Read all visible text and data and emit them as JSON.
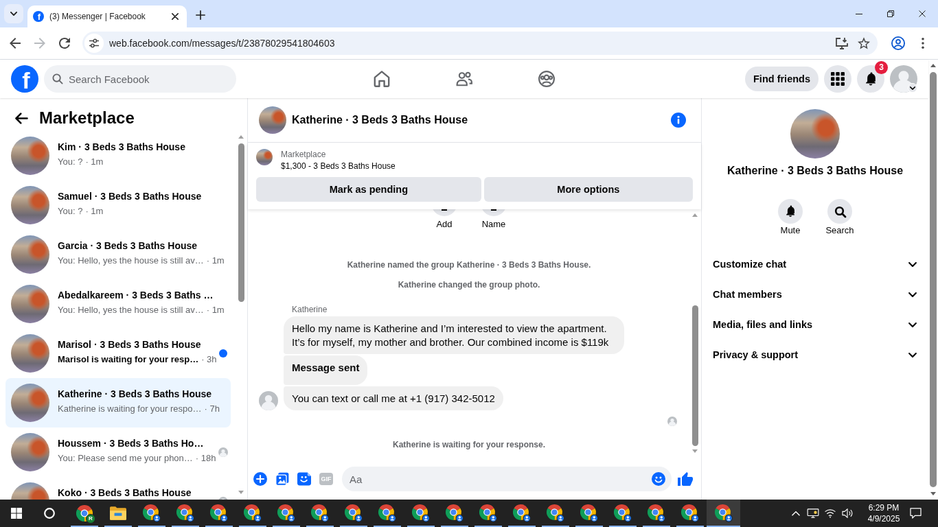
{
  "browser": {
    "tab": {
      "favicon": "f",
      "title": "(3) Messenger | Facebook"
    },
    "nav_buttons": [
      {
        "kind": "back",
        "disabled": false
      },
      {
        "kind": "forward",
        "disabled": true
      },
      {
        "kind": "reload",
        "disabled": false
      }
    ],
    "url": "web.facebook.com/messages/t/23878029541804603"
  },
  "topbar": {
    "logo": "f",
    "search": {
      "placeholder": "Search Facebook"
    },
    "nav": [
      {
        "kind": "home",
        "selected": false
      },
      {
        "kind": "friends",
        "selected": false
      },
      {
        "kind": "groups",
        "selected": false
      }
    ],
    "find_friends": "Find friends",
    "notifications": "3"
  },
  "sidebar": {
    "title": "Marketplace",
    "conversations": [
      {
        "name": "Kim · 3 Beds 3 Baths House",
        "snippet": "You: ?",
        "time": "· 1m",
        "selected": false,
        "unread": false,
        "seen": false
      },
      {
        "name": "Samuel · 3 Beds 3 Baths House",
        "snippet": "You: ?",
        "time": "· 1m",
        "selected": false,
        "unread": false,
        "seen": false
      },
      {
        "name": "Garcia · 3 Beds 3 Baths House",
        "snippet": "You: Hello, yes the house is still av…",
        "time": "· 1m",
        "selected": false,
        "unread": false,
        "seen": false
      },
      {
        "name": "Abedalkareem · 3 Beds 3 Baths …",
        "snippet": "You: Hello, yes the house is still av…",
        "time": "· 1m",
        "selected": false,
        "unread": false,
        "seen": false
      },
      {
        "name": "Marisol · 3 Beds 3 Baths House",
        "snippet": "Marisol is waiting for your resp…",
        "time": "· 3h",
        "selected": false,
        "unread": true,
        "seen": false
      },
      {
        "name": "Katherine · 3 Beds 3 Baths House",
        "snippet": "Katherine is waiting for your respo…",
        "time": "· 7h",
        "selected": true,
        "unread": false,
        "seen": false
      },
      {
        "name": "Houssem · 3 Beds 3 Baths Ho…",
        "snippet": "You: Please send me your phon…",
        "time": "· 18h",
        "selected": false,
        "unread": false,
        "seen": true
      },
      {
        "name": "Koko · 3 Beds 3 Baths House",
        "selected": false,
        "unread": false,
        "seen": true
      }
    ]
  },
  "chat": {
    "title": "Katherine · 3 Beds 3 Baths House",
    "listing": {
      "label": "Marketplace",
      "summary": "$1,300 - 3 Beds 3 Baths House",
      "actions": [
        "Mark as pending",
        "More options"
      ]
    },
    "group_actions": [
      "Add",
      "Name"
    ],
    "thread": [
      {
        "kind": "system",
        "text": "Katherine named the group Katherine · 3 Beds 3 Baths House."
      },
      {
        "kind": "system",
        "text": "Katherine changed the group photo."
      },
      {
        "kind": "sender",
        "text": "Katherine"
      },
      {
        "kind": "message",
        "text": "Hello my name is Katherine and I’m interested to view the apartment. It’s for myself, my mother and brother. Our combined income is $119k",
        "avatar": false
      },
      {
        "kind": "notice",
        "text": "Message sent",
        "avatar": false
      },
      {
        "kind": "message",
        "text": "You can text or call me at +1 (917) 342-5012",
        "avatar": true
      },
      {
        "kind": "seen"
      },
      {
        "kind": "system",
        "text": "Katherine is waiting for your response."
      }
    ],
    "composer": {
      "gif": "GIF",
      "placeholder": "Aa"
    }
  },
  "details": {
    "title": "Katherine · 3 Beds 3 Baths House",
    "actions": [
      {
        "kind": "mute",
        "label": "Mute"
      },
      {
        "kind": "search",
        "label": "Search"
      }
    ],
    "sections": [
      {
        "label": "Customize chat",
        "expanded": false
      },
      {
        "label": "Chat members",
        "expanded": false
      },
      {
        "label": "Media, files and links",
        "expanded": false
      },
      {
        "label": "Privacy & support",
        "expanded": false
      }
    ]
  },
  "taskbar": {
    "apps": [
      {
        "kind": "browser",
        "badge": "R",
        "selected": false
      },
      {
        "kind": "folder",
        "selected": false
      },
      {
        "kind": "browser",
        "selected": false
      },
      {
        "kind": "browser",
        "selected": false
      },
      {
        "kind": "browser",
        "selected": false
      },
      {
        "kind": "browser",
        "selected": false
      },
      {
        "kind": "browser",
        "selected": false
      },
      {
        "kind": "browser",
        "selected": false
      },
      {
        "kind": "browser",
        "selected": false
      },
      {
        "kind": "browser",
        "selected": false
      },
      {
        "kind": "browser",
        "selected": false
      },
      {
        "kind": "browser",
        "selected": false
      },
      {
        "kind": "browser",
        "selected": false
      },
      {
        "kind": "browser",
        "selected": false
      },
      {
        "kind": "browser",
        "selected": false
      },
      {
        "kind": "browser",
        "selected": false
      },
      {
        "kind": "browser",
        "selected": false
      },
      {
        "kind": "browser",
        "selected": false
      },
      {
        "kind": "browser",
        "selected": false
      },
      {
        "kind": "browser",
        "selected": true
      }
    ],
    "time": "6:29 PM",
    "date": "4/9/2025"
  }
}
